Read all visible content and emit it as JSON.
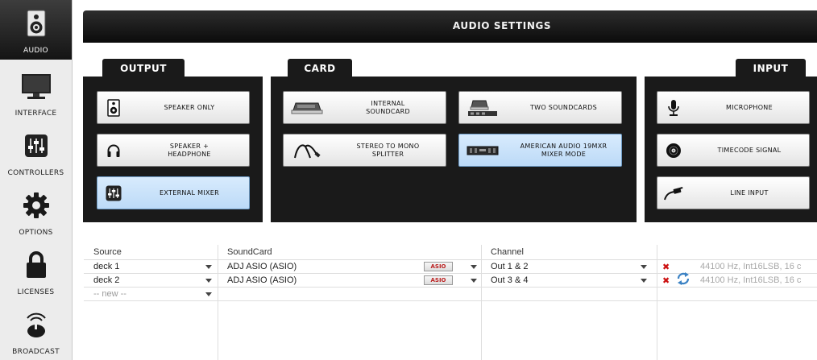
{
  "sidebar": {
    "items": [
      {
        "label": "AUDIO",
        "icon": "speaker-icon",
        "active": true
      },
      {
        "label": "INTERFACE",
        "icon": "monitor-icon"
      },
      {
        "label": "CONTROLLERS",
        "icon": "mixer-sliders-icon"
      },
      {
        "label": "OPTIONS",
        "icon": "gear-icon"
      },
      {
        "label": "LICENSES",
        "icon": "lock-icon"
      },
      {
        "label": "BROADCAST",
        "icon": "broadcast-icon"
      }
    ]
  },
  "header": {
    "title": "AUDIO SETTINGS"
  },
  "sections": {
    "output": {
      "tab": "OUTPUT",
      "buttons": [
        {
          "label": "SPEAKER ONLY",
          "icon": "speaker-icon"
        },
        {
          "label": "SPEAKER +\nHEADPHONE",
          "icon": "headphone-icon"
        },
        {
          "label": "EXTERNAL MIXER",
          "icon": "mixer-sliders-icon",
          "selected": true
        }
      ]
    },
    "card": {
      "tab": "CARD",
      "buttons": [
        {
          "label": "INTERNAL\nSOUNDCARD",
          "icon": "soundcard-icon"
        },
        {
          "label": "TWO SOUNDCARDS",
          "icon": "two-soundcards-icon"
        },
        {
          "label": "STEREO TO MONO\nSPLITTER",
          "icon": "splitter-cable-icon"
        },
        {
          "label": "AMERICAN AUDIO 19MXR\nMIXER MODE",
          "icon": "dj-mixer-icon",
          "selected": true
        }
      ]
    },
    "input": {
      "tab": "INPUT",
      "buttons": [
        {
          "label": "MICROPHONE",
          "icon": "microphone-icon"
        },
        {
          "label": "TIMECODE SIGNAL",
          "icon": "vinyl-icon"
        },
        {
          "label": "LINE INPUT",
          "icon": "cable-icon"
        }
      ]
    }
  },
  "table": {
    "headers": {
      "source": "Source",
      "soundcard": "SoundCard",
      "channel": "Channel"
    },
    "rows": [
      {
        "source": "deck 1",
        "soundcard": "ADJ ASIO (ASIO)",
        "asio": "ASIO",
        "channel": "Out 1 & 2",
        "info": "44100 Hz, Int16LSB, 16 c"
      },
      {
        "source": "deck 2",
        "soundcard": "ADJ ASIO (ASIO)",
        "asio": "ASIO",
        "channel": "Out 3 & 4",
        "info": "44100 Hz, Int16LSB, 16 c"
      }
    ],
    "new_row": {
      "source": "-- new --"
    }
  },
  "colors": {
    "selected_button": "#c7e0f9",
    "panel": "#1a1a1a",
    "delete": "#cc1111"
  }
}
